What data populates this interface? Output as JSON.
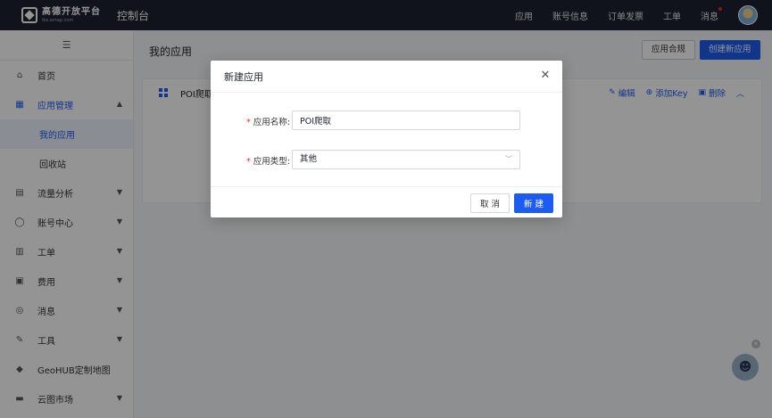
{
  "topbar": {
    "logo_title": "高德开放平台",
    "logo_sub": "lbs.amap.com",
    "console": "控制台",
    "nav": [
      "应用",
      "账号信息",
      "订单发票",
      "工单",
      "消息"
    ]
  },
  "sidebar": {
    "collapse_icon": "menu-icon",
    "items": [
      {
        "label": "首页",
        "icon": "home-icon"
      },
      {
        "label": "应用管理",
        "icon": "apps-icon"
      },
      {
        "label": "我的应用"
      },
      {
        "label": "回收站"
      },
      {
        "label": "流量分析",
        "icon": "chart-icon"
      },
      {
        "label": "账号中心",
        "icon": "user-icon"
      },
      {
        "label": "工单",
        "icon": "ticket-icon"
      },
      {
        "label": "费用",
        "icon": "fee-icon"
      },
      {
        "label": "消息",
        "icon": "message-icon"
      },
      {
        "label": "工具",
        "icon": "tool-icon"
      },
      {
        "label": "GeoHUB定制地图",
        "icon": "layers-icon"
      },
      {
        "label": "云图市场",
        "icon": "store-icon"
      }
    ]
  },
  "main": {
    "title": "我的应用",
    "compliance_button": "应用合规",
    "create_button": "创建新应用",
    "card": {
      "name": "POI爬取",
      "actions": {
        "edit": "编辑",
        "add_key": "添加Key",
        "delete": "删除"
      }
    }
  },
  "modal": {
    "title": "新建应用",
    "fields": {
      "name_label": "应用名称:",
      "name_value": "POI爬取",
      "type_label": "应用类型:",
      "type_value": "其他"
    },
    "cancel": "取 消",
    "create": "新 建"
  },
  "colors": {
    "primary": "#1d5cf0",
    "topbar": "#1d2130",
    "required": "#f5222d"
  }
}
